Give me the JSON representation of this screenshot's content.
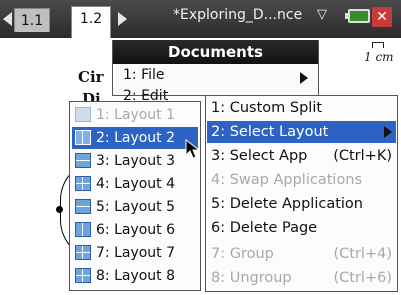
{
  "tabbar": {
    "tabs": [
      {
        "label": "1.1",
        "active": false
      },
      {
        "label": "1.2",
        "active": true
      }
    ],
    "document_title": "*Exploring_D...nce",
    "chevron": "▽",
    "close": "✕"
  },
  "page": {
    "text_fragment_1": "Cir",
    "text_fragment_2": "Di",
    "scale_label": "1 cm"
  },
  "documents_menu": {
    "title": "Documents",
    "items": [
      {
        "label": "1: File"
      },
      {
        "label": "2: Edit"
      }
    ]
  },
  "layouts": [
    {
      "label": "1: Layout 1",
      "state": "disabled",
      "icon": "layout-single-icon"
    },
    {
      "label": "2: Layout 2",
      "state": "selected",
      "icon": "layout-vertical-split-icon"
    },
    {
      "label": "3: Layout 3",
      "state": "normal",
      "icon": "layout-horizontal-split-icon"
    },
    {
      "label": "4: Layout 4",
      "state": "normal",
      "icon": "layout-left-right-split-icon"
    },
    {
      "label": "5: Layout 5",
      "state": "normal",
      "icon": "layout-top-bottom-split-icon"
    },
    {
      "label": "6: Layout 6",
      "state": "normal",
      "icon": "layout-three-panel-icon"
    },
    {
      "label": "7: Layout 7",
      "state": "normal",
      "icon": "layout-three-panel-alt-icon"
    },
    {
      "label": "8: Layout 8",
      "state": "normal",
      "icon": "layout-quad-icon"
    }
  ],
  "split_menu": [
    {
      "label": "1: Custom Split",
      "shortcut": "",
      "state": "normal"
    },
    {
      "label": "2: Select Layout",
      "shortcut": "",
      "state": "selected",
      "submenu": true
    },
    {
      "label": "3: Select App",
      "shortcut": "(Ctrl+K)",
      "state": "normal"
    },
    {
      "label": "4: Swap Applications",
      "shortcut": "",
      "state": "disabled"
    },
    {
      "label": "5: Delete Application",
      "shortcut": "",
      "state": "normal"
    },
    {
      "label": "6: Delete Page",
      "shortcut": "",
      "state": "normal"
    },
    {
      "label": "7: Group",
      "shortcut": "(Ctrl+4)",
      "state": "disabled"
    },
    {
      "label": "8: Ungroup",
      "shortcut": "(Ctrl+6)",
      "state": "disabled"
    }
  ],
  "colors": {
    "selection": "#2d63c4",
    "tabbar": "#2b2b2b",
    "disabled_text": "#a8a8a8",
    "battery": "#3a8a2e",
    "close_button": "#c73b3b"
  }
}
